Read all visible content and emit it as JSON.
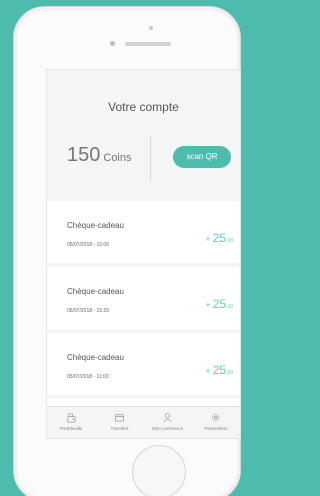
{
  "colors": {
    "accent": "#4dbcac",
    "value": "#5ecfbf"
  },
  "header": {
    "title": "Votre compte"
  },
  "balance": {
    "amount": "150",
    "unit": "Coins"
  },
  "scan": {
    "label": "scan QR"
  },
  "transactions": [
    {
      "label": "Chèque-cadeau",
      "date": "05/07/2018 - 15:06",
      "sign": "+",
      "amount_int": "25",
      "amount_dec": ",00"
    },
    {
      "label": "Chèque-cadeau",
      "date": "05/07/2018 - 15:20",
      "sign": "+",
      "amount_int": "25",
      "amount_dec": ",00"
    },
    {
      "label": "Chèque-cadeau",
      "date": "05/07/2018 - 11:00",
      "sign": "+",
      "amount_int": "25",
      "amount_dec": ",00"
    }
  ],
  "tabs": [
    {
      "label": "Portefeuille",
      "icon": "wallet-icon"
    },
    {
      "label": "Transfert",
      "icon": "transfer-icon"
    },
    {
      "label": "Mon commerce",
      "icon": "user-icon"
    },
    {
      "label": "Paramètres",
      "icon": "gear-icon"
    }
  ]
}
